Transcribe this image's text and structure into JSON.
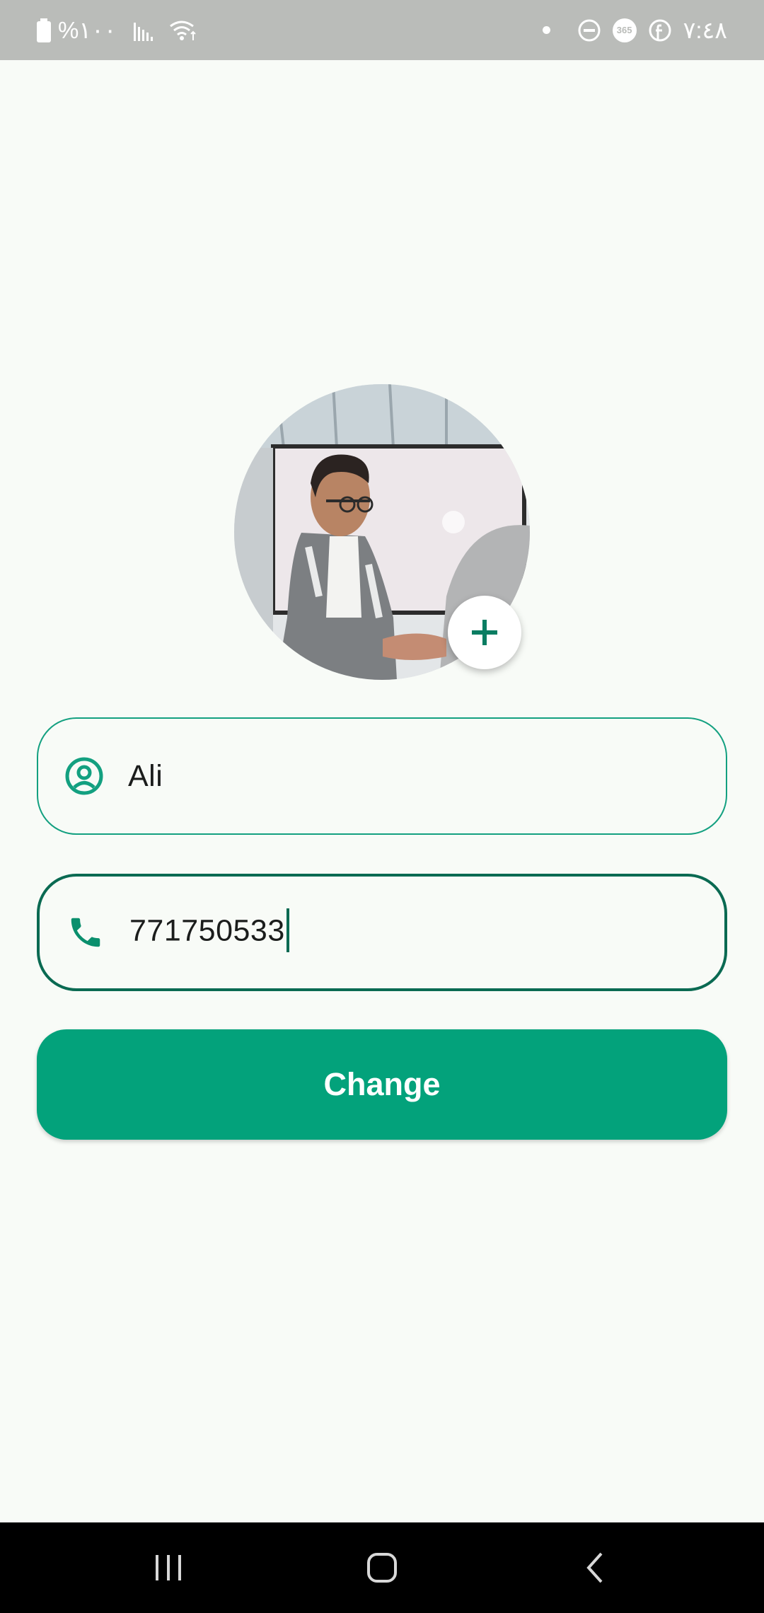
{
  "status_bar": {
    "battery_text": "%١٠٠",
    "time": "٧:٤٨",
    "badge_365": "365"
  },
  "profile": {
    "name_value": "Ali",
    "phone_value": "771750533",
    "change_label": "Change"
  },
  "colors": {
    "accent": "#03a27b",
    "accent_dark": "#0a6a52",
    "background": "#f8fbf7",
    "status_bar": "#babcb9"
  },
  "icons": {
    "name_field": "person-circle-icon",
    "phone_field": "phone-icon",
    "avatar_button": "plus-icon",
    "nav": [
      "recent-apps-icon",
      "home-icon",
      "back-icon"
    ]
  }
}
